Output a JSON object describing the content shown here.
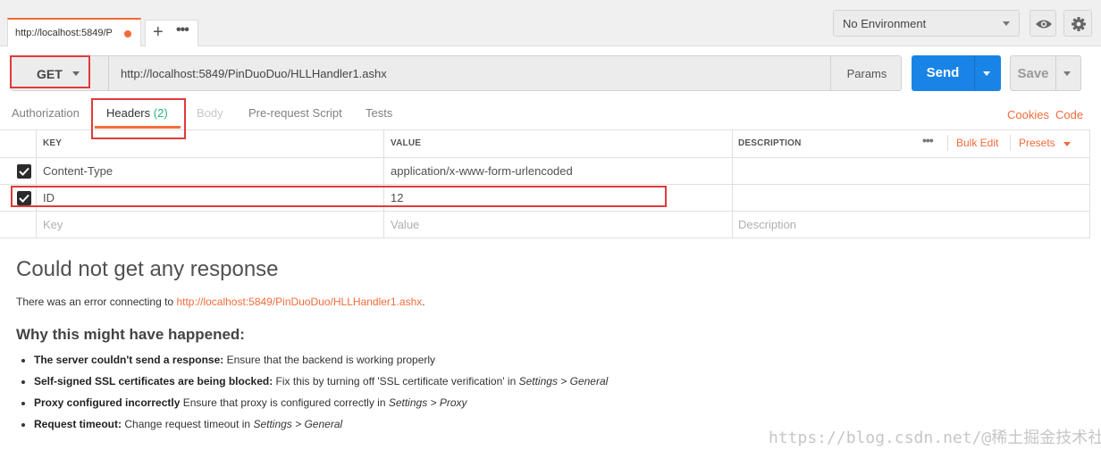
{
  "tabbar": {
    "request_tab_label": "http://localhost:5849/P",
    "environment": "No Environment"
  },
  "request": {
    "method": "GET",
    "url": "http://localhost:5849/PinDuoDuo/HLLHandler1.ashx",
    "params_label": "Params",
    "send_label": "Send",
    "save_label": "Save"
  },
  "request_tabs": {
    "authorization": "Authorization",
    "headers": "Headers",
    "headers_count": "(2)",
    "body": "Body",
    "prerequest": "Pre-request Script",
    "tests": "Tests",
    "cookies": "Cookies",
    "code": "Code"
  },
  "headers_table": {
    "col_key": "KEY",
    "col_value": "VALUE",
    "col_description": "DESCRIPTION",
    "bulk_edit": "Bulk Edit",
    "presets": "Presets",
    "rows": [
      {
        "key": "Content-Type",
        "value": "application/x-www-form-urlencoded",
        "description": "",
        "checked": true
      },
      {
        "key": "ID",
        "value": "12",
        "description": "",
        "checked": true
      }
    ],
    "placeholder": {
      "key": "Key",
      "value": "Value",
      "description": "Description"
    }
  },
  "response": {
    "title": "Could not get any response",
    "error_prefix": "There was an error connecting to ",
    "error_url": "http://localhost:5849/PinDuoDuo/HLLHandler1.ashx",
    "error_suffix": ".",
    "why_title": "Why this might have happened:",
    "reasons": [
      {
        "bold": "The server couldn't send a response:",
        "text": " Ensure that the backend is working properly",
        "italic": "",
        "tail": ""
      },
      {
        "bold": "Self-signed SSL certificates are being blocked:",
        "text": " Fix this by turning off 'SSL certificate verification' in ",
        "italic": "Settings > General",
        "tail": ""
      },
      {
        "bold": "Proxy configured incorrectly",
        "text": " Ensure that proxy is configured correctly in ",
        "italic": "Settings > Proxy",
        "tail": ""
      },
      {
        "bold": "Request timeout:",
        "text": " Change request timeout in ",
        "italic": "Settings > General",
        "tail": ""
      }
    ]
  },
  "watermark": "https://blog.csdn.net/@稀土掘金技术社区",
  "colors": {
    "accent_orange": "#f26b3a",
    "send_blue": "#1a84e6",
    "count_green": "#26b47f",
    "annotation_red": "#e03a3a"
  }
}
